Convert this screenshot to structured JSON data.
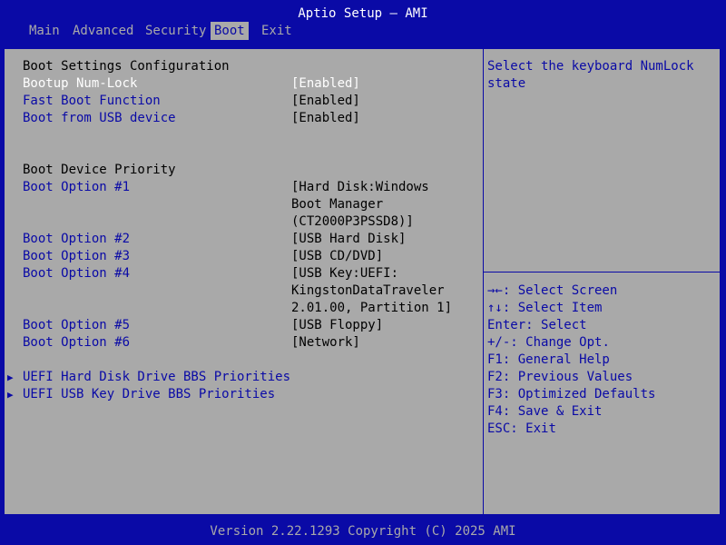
{
  "window": {
    "title": "Aptio Setup – AMI"
  },
  "menu": {
    "tabs": [
      {
        "label": "Main"
      },
      {
        "label": "Advanced"
      },
      {
        "label": "Security"
      },
      {
        "label": "Boot"
      },
      {
        "label": "Exit"
      }
    ],
    "active": "Boot"
  },
  "boot_settings": {
    "heading": "Boot Settings Configuration",
    "items": [
      {
        "label": "Bootup Num-Lock",
        "value": "[Enabled]"
      },
      {
        "label": "Fast Boot Function",
        "value": "[Enabled]"
      },
      {
        "label": "Boot from USB device",
        "value": "[Enabled]"
      }
    ]
  },
  "priority": {
    "heading": "Boot Device Priority",
    "options": [
      {
        "label": "Boot Option #1",
        "value_lines": [
          "[Hard Disk:Windows",
          "Boot Manager",
          "(CT2000P3PSSD8)]"
        ]
      },
      {
        "label": "Boot Option #2",
        "value_lines": [
          "[USB Hard Disk]"
        ]
      },
      {
        "label": "Boot Option #3",
        "value_lines": [
          "[USB CD/DVD]"
        ]
      },
      {
        "label": "Boot Option #4",
        "value_lines": [
          "[USB Key:UEFI:",
          "KingstonDataTraveler",
          "2.01.00, Partition 1]"
        ]
      },
      {
        "label": "Boot Option #5",
        "value_lines": [
          "[USB Floppy]"
        ]
      },
      {
        "label": "Boot Option #6",
        "value_lines": [
          "[Network]"
        ]
      }
    ]
  },
  "submenus": [
    {
      "label": "UEFI Hard Disk Drive BBS Priorities",
      "icon": "triangle-right-icon"
    },
    {
      "label": "UEFI USB Key Drive BBS Priorities",
      "icon": "triangle-right-icon"
    }
  ],
  "help": {
    "description": [
      "Select the keyboard NumLock",
      "state"
    ],
    "keys": [
      {
        "key": "→←",
        "text": ": Select Screen"
      },
      {
        "key": "↑↓",
        "text": ": Select Item"
      },
      {
        "key": "Enter",
        "text": ": Select"
      },
      {
        "key": "+/-",
        "text": ": Change Opt."
      },
      {
        "key": "F1",
        "text": ": General Help"
      },
      {
        "key": "F2",
        "text": ": Previous Values"
      },
      {
        "key": "F3",
        "text": ": Optimized Defaults"
      },
      {
        "key": "F4",
        "text": ": Save & Exit"
      },
      {
        "key": "ESC",
        "text": ": Exit"
      }
    ]
  },
  "footer": {
    "text": "Version 2.22.1293 Copyright (C) 2025 AMI"
  },
  "colors": {
    "background": "#0a0aa6",
    "panel": "#a9a9a9",
    "highlight": "#ffffff",
    "link": "#0a0aa6"
  }
}
